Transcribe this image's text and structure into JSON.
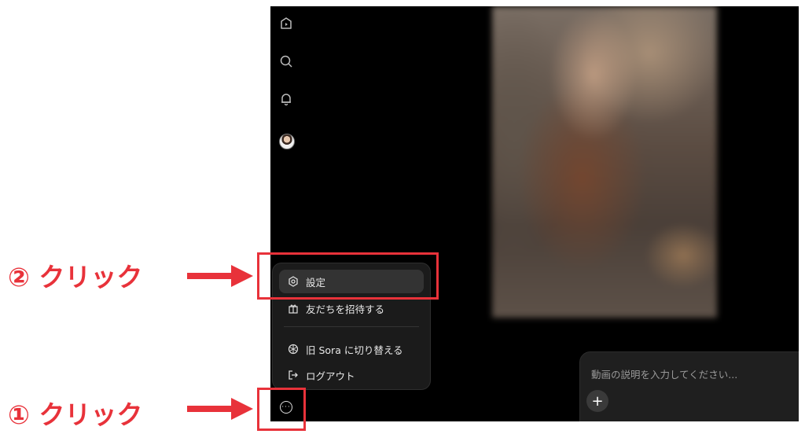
{
  "sidebar": {
    "icons": [
      "home-play-icon",
      "search-icon",
      "bell-icon",
      "avatar"
    ]
  },
  "menu": {
    "items": [
      {
        "label": "設定",
        "icon": "gear-icon"
      },
      {
        "label": "友だちを招待する",
        "icon": "gift-icon"
      },
      {
        "label": "旧 Sora に切り替える",
        "icon": "openai-logo-icon"
      },
      {
        "label": "ログアウト",
        "icon": "logout-icon"
      }
    ]
  },
  "prompt": {
    "placeholder": "動画の説明を入力してください...",
    "add_label": "+"
  },
  "annotations": {
    "step1": "① クリック",
    "step2": "② クリック",
    "color": "#e8323a"
  }
}
